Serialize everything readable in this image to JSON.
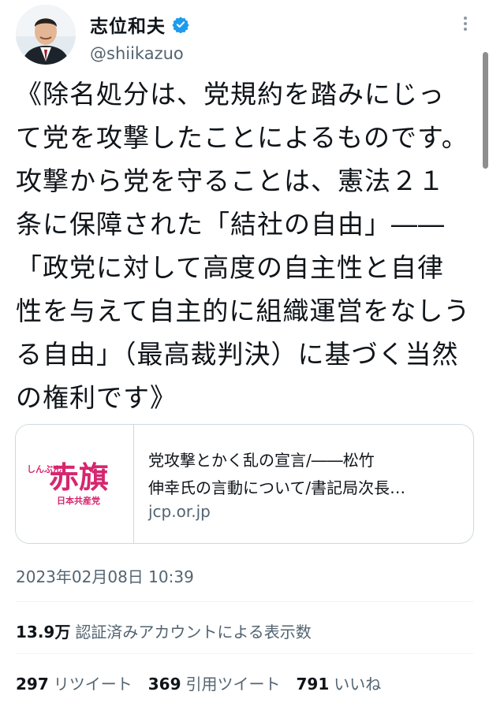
{
  "author": {
    "display_name": "志位和夫",
    "handle": "@shiikazuo",
    "verified_icon": "verified-badge-icon",
    "verified_color": "#1d9bf0"
  },
  "tweet": {
    "text": "《除名処分は、党規約を踏みにじっ\nて党を攻撃したことによるものです。\n攻撃から党を守ることは、憲法２１\n条に保障された「結社の自由」――\n「政党に対して高度の自主性と自律\n性を与えて自主的に組織運営をなしう\nる自由」（最高裁判決）に基づく当然\nの権利です》"
  },
  "card": {
    "logo_kana": "しんぶん",
    "logo_kanji": "赤旗",
    "logo_sub": "日本共産党",
    "logo_color": "#d6266f",
    "title": "党攻撃とかく乱の宣言/――松竹\n伸幸氏の言動について/書記局次長…",
    "domain": "jcp.or.jp"
  },
  "timestamp": "2023年02月08日 10:39",
  "views": {
    "count": "13.9万",
    "label": "認証済みアカウントによる表示数"
  },
  "stats": {
    "retweets": {
      "count": "297",
      "label": "リツイート"
    },
    "quotes": {
      "count": "369",
      "label": "引用ツイート"
    },
    "likes": {
      "count": "791",
      "label": "いいね"
    }
  }
}
